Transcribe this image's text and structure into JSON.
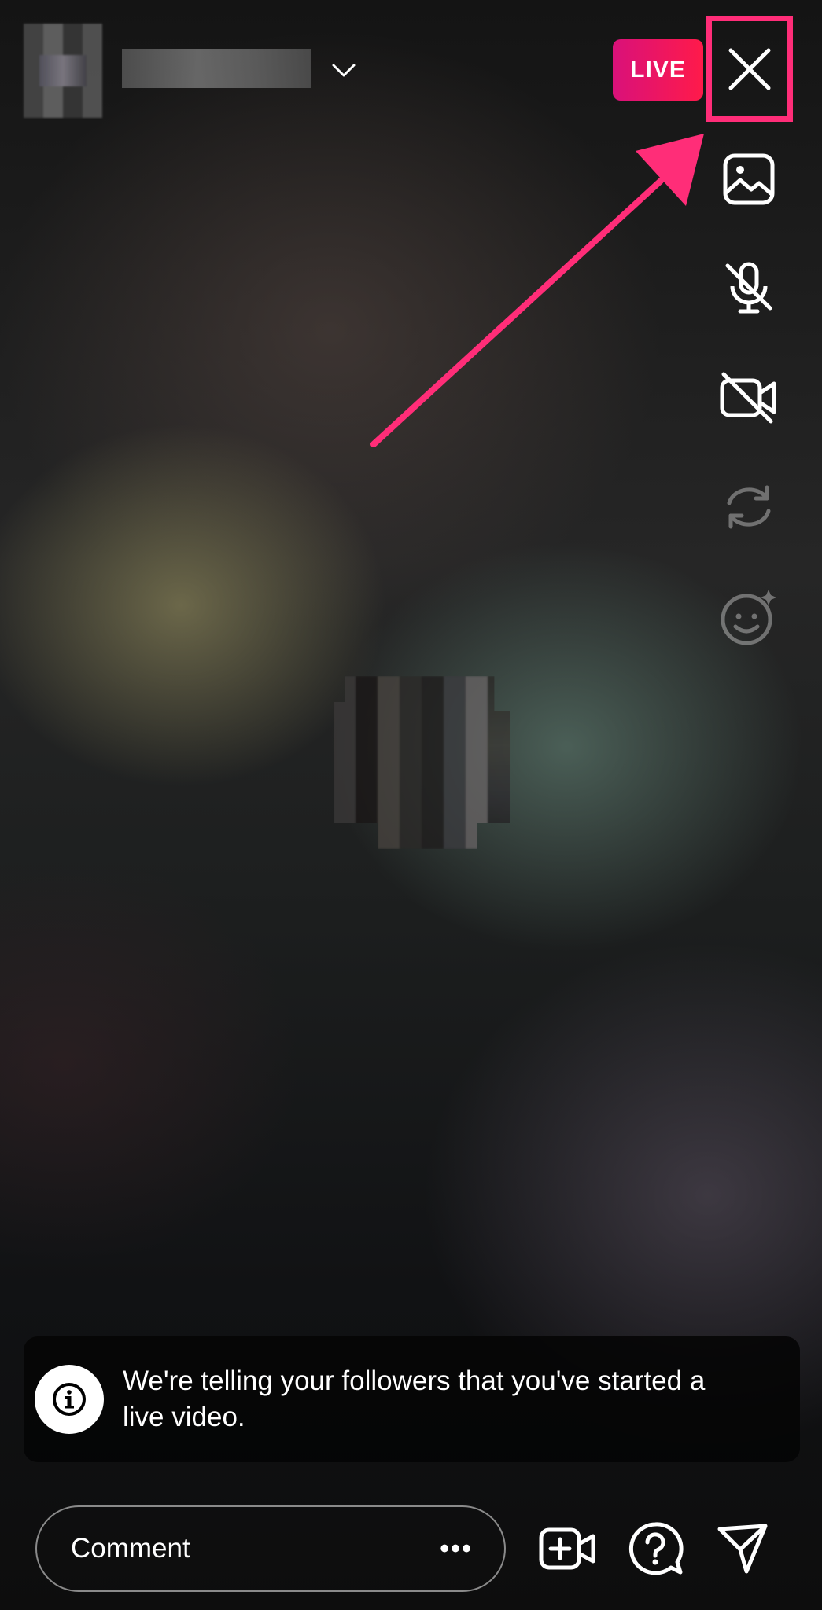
{
  "header": {
    "live_badge": "LIVE",
    "chevron_icon": "chevron-down-icon",
    "close_icon": "close-icon"
  },
  "side_controls": [
    {
      "icon": "image-icon"
    },
    {
      "icon": "mic-off-icon"
    },
    {
      "icon": "video-off-icon"
    },
    {
      "icon": "flip-camera-icon"
    },
    {
      "icon": "face-effects-icon"
    }
  ],
  "notice": {
    "icon": "info-icon",
    "text": "We're telling your followers that you've started a live video."
  },
  "bottom_bar": {
    "comment_placeholder": "Comment",
    "more_label": "•••",
    "icons": [
      "add-guest-icon",
      "question-icon",
      "send-icon"
    ]
  },
  "colors": {
    "live_gradient_start": "#d9117a",
    "live_gradient_end": "#ff1a4a",
    "highlight": "#ff2d78"
  }
}
